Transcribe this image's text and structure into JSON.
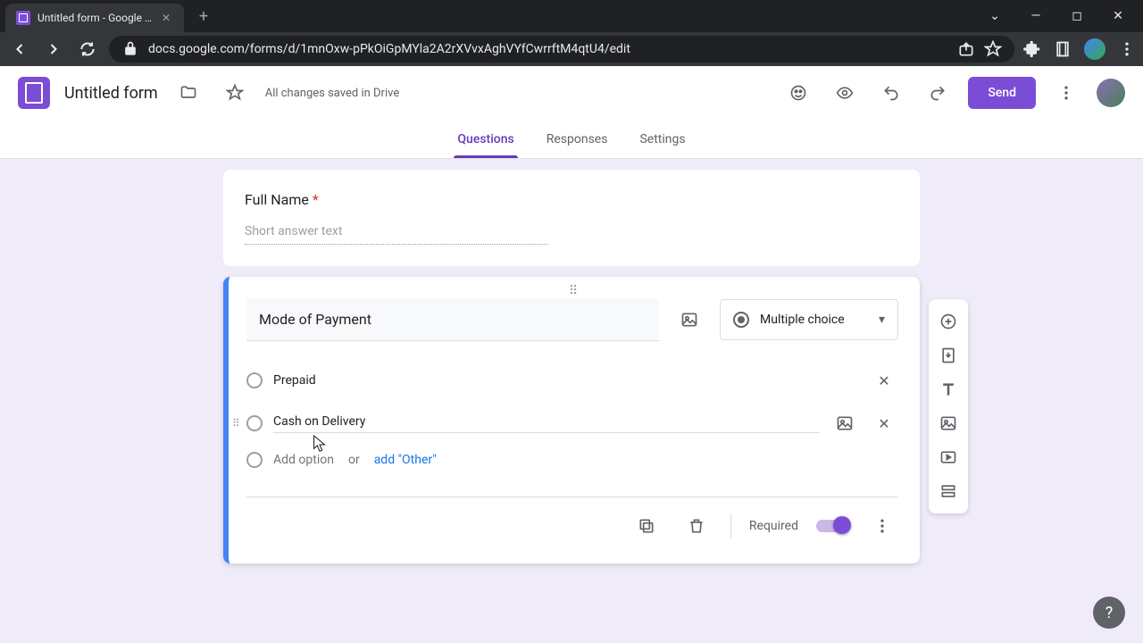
{
  "browser": {
    "tab_title": "Untitled form - Google Forms",
    "url": "docs.google.com/forms/d/1mnOxw-pPkOiGpMYla2A2rXVvxAghVYfCwrrftM4qtU4/edit"
  },
  "header": {
    "title": "Untitled form",
    "save_status": "All changes saved in Drive",
    "send_label": "Send"
  },
  "nav": {
    "tabs": [
      "Questions",
      "Responses",
      "Settings"
    ],
    "active": 0
  },
  "questions": [
    {
      "title": "Full Name",
      "required": true,
      "placeholder": "Short answer text",
      "type": "short_answer"
    },
    {
      "title": "Mode of Payment",
      "type_label": "Multiple choice",
      "options": [
        "Prepaid",
        "Cash on Delivery"
      ],
      "add_option_placeholder": "Add option",
      "or_text": "or",
      "add_other": "add \"Other\"",
      "required_label": "Required",
      "required": true
    }
  ],
  "colors": {
    "accent": "#7b4dd6",
    "blue": "#4285f4",
    "link": "#1a73e8"
  }
}
